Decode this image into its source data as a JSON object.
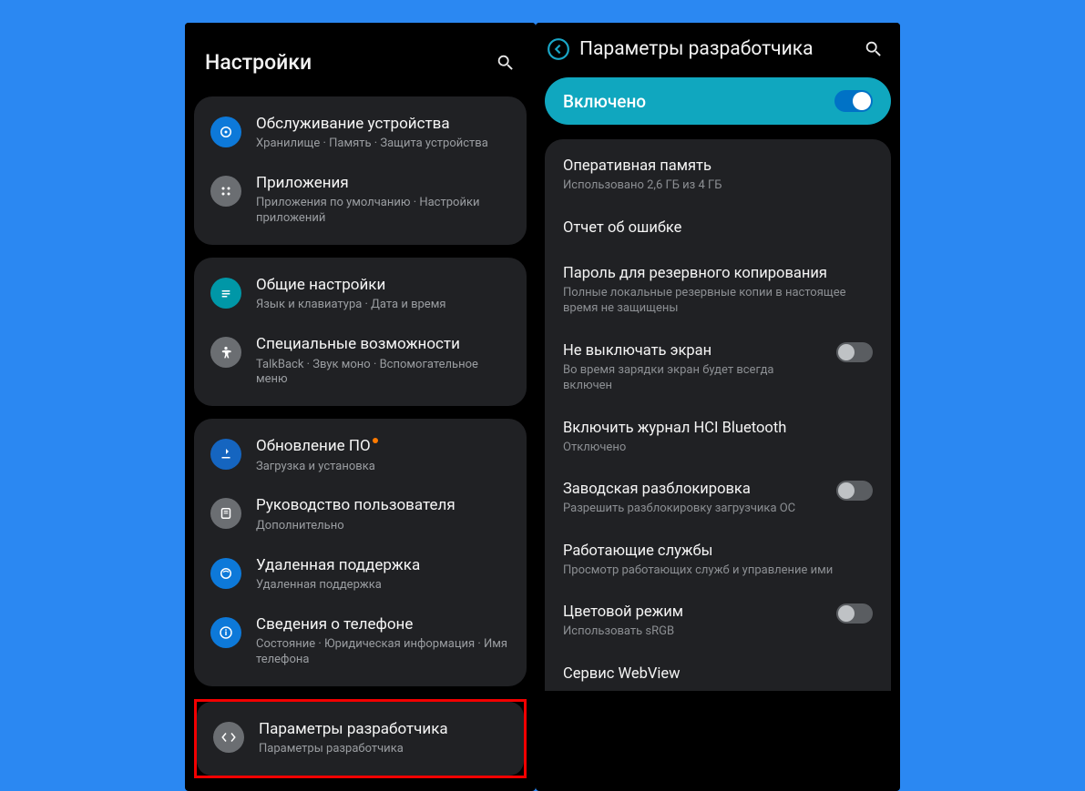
{
  "left": {
    "title": "Настройки",
    "groups": [
      [
        {
          "icon": "device-care",
          "title": "Обслуживание устройства",
          "sub": "Хранилище · Память · Защита устройства"
        },
        {
          "icon": "apps",
          "title": "Приложения",
          "sub": "Приложения по умолчанию · Настройки приложений"
        }
      ],
      [
        {
          "icon": "general",
          "title": "Общие настройки",
          "sub": "Язык и клавиатура · Дата и время"
        },
        {
          "icon": "accessibility",
          "title": "Специальные возможности",
          "sub": "TalkBack · Звук моно · Вспомогательное меню"
        }
      ],
      [
        {
          "icon": "update",
          "title": "Обновление ПО",
          "sub": "Загрузка и установка",
          "dot": true
        },
        {
          "icon": "manual",
          "title": "Руководство пользователя",
          "sub": "Дополнительно"
        },
        {
          "icon": "remote",
          "title": "Удаленная поддержка",
          "sub": "Удаленная поддержка"
        },
        {
          "icon": "about",
          "title": "Сведения о телефоне",
          "sub": "Состояние · Юридическая информация · Имя телефона"
        }
      ]
    ],
    "highlighted": {
      "icon": "devopts",
      "title": "Параметры разработчика",
      "sub": "Параметры разработчика"
    }
  },
  "right": {
    "title": "Параметры разработчика",
    "enabled_label": "Включено",
    "items": [
      {
        "title": "Оперативная память",
        "sub": "Использовано 2,6 ГБ из 4 ГБ"
      },
      {
        "title": "Отчет об ошибке"
      },
      {
        "title": "Пароль для резервного копирования",
        "sub": "Полные локальные резервные копии в настоящее время не защищены"
      },
      {
        "title": "Не выключать экран",
        "sub": "Во время зарядки экран будет всегда включен",
        "toggle": false
      },
      {
        "title": "Включить журнал HCI Bluetooth",
        "sub": "Отключено"
      },
      {
        "title": "Заводская разблокировка",
        "sub": "Разрешить разблокировку загрузчика ОС",
        "toggle": false
      },
      {
        "title": "Работающие службы",
        "sub": "Просмотр работающих служб и управление ими"
      },
      {
        "title": "Цветовой режим",
        "sub": "Использовать sRGB",
        "toggle": false
      },
      {
        "title": "Сервис WebView"
      }
    ]
  }
}
